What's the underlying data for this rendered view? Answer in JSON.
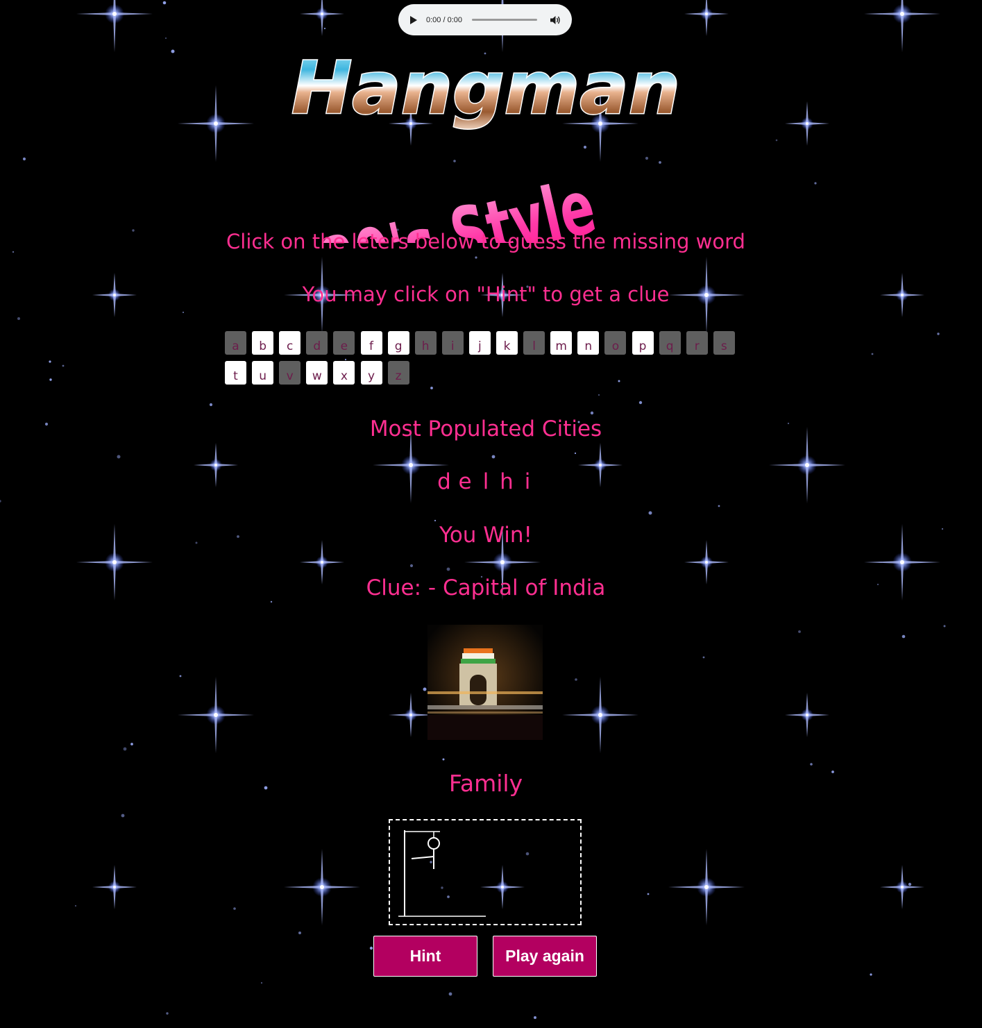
{
  "audio": {
    "time": "0:00 / 0:00"
  },
  "title": {
    "main": "Hangman",
    "sub": "80's Style"
  },
  "instructions": {
    "line1": "Click on the leters below to guess the missing word",
    "line2": "You may click on \"Hint\" to get a clue"
  },
  "letters": [
    {
      "char": "a",
      "used": true
    },
    {
      "char": "b",
      "used": false
    },
    {
      "char": "c",
      "used": false
    },
    {
      "char": "d",
      "used": true
    },
    {
      "char": "e",
      "used": true
    },
    {
      "char": "f",
      "used": false
    },
    {
      "char": "g",
      "used": false
    },
    {
      "char": "h",
      "used": true
    },
    {
      "char": "i",
      "used": true
    },
    {
      "char": "j",
      "used": false
    },
    {
      "char": "k",
      "used": false
    },
    {
      "char": "l",
      "used": true
    },
    {
      "char": "m",
      "used": false
    },
    {
      "char": "n",
      "used": false
    },
    {
      "char": "o",
      "used": true
    },
    {
      "char": "p",
      "used": false
    },
    {
      "char": "q",
      "used": true
    },
    {
      "char": "r",
      "used": true
    },
    {
      "char": "s",
      "used": true
    },
    {
      "char": "t",
      "used": false
    },
    {
      "char": "u",
      "used": false
    },
    {
      "char": "v",
      "used": true
    },
    {
      "char": "w",
      "used": false
    },
    {
      "char": "x",
      "used": false
    },
    {
      "char": "y",
      "used": false
    },
    {
      "char": "z",
      "used": true
    }
  ],
  "game": {
    "category": "Most Populated Cities",
    "word": [
      "d",
      "e",
      "l",
      "h",
      "i"
    ],
    "status": "You Win!",
    "clue": "Clue: - Capital of India",
    "lives_label": "Family"
  },
  "buttons": {
    "hint": "Hint",
    "play_again": "Play again"
  },
  "colors": {
    "accent_text": "#ff2f91",
    "button_bg": "#b30060",
    "key_available": "#ffffff",
    "key_used": "#5f5f5f"
  },
  "icons": {
    "play": "play-icon",
    "volume": "volume-icon",
    "photo": "india-gate-photo"
  }
}
